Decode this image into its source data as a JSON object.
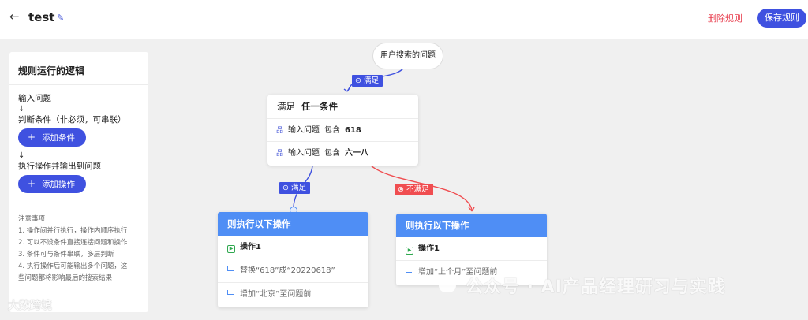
{
  "header": {
    "title": "test",
    "delete_label": "删除规则",
    "save_label": "保存规则"
  },
  "panel": {
    "title": "规则运行的逻辑",
    "step1": "输入问题",
    "arrow": "↓",
    "step2": "判断条件（非必须，可串联）",
    "add_condition": "添加条件",
    "step3": "执行操作并输出到问题",
    "add_action": "添加操作",
    "notes_title": "注意事项",
    "notes": [
      "1. 操作间并行执行，操作内顺序执行",
      "2. 可以不设条件直接连接问题和操作",
      "3. 条件可与条件串联，多层判断",
      "4. 执行操作后可能输出多个问题，这",
      "些问题都将影响最后的搜索结果"
    ]
  },
  "flow": {
    "start_node": "用户搜索的问题",
    "tag_satisfy_top": "满足",
    "condition": {
      "head_label": "满足",
      "head_value": "任一条件",
      "rows": [
        {
          "field": "输入问题",
          "op": "包含",
          "value": "618"
        },
        {
          "field": "输入问题",
          "op": "包含",
          "value": "六一八"
        }
      ]
    },
    "tag_satisfy": "满足",
    "tag_not_satisfy": "不满足",
    "action_left": {
      "head": "则执行以下操作",
      "op_name": "操作1",
      "steps": [
        "替换“618”成“20220618”",
        "增加“北京”至问题前"
      ]
    },
    "action_right": {
      "head": "则执行以下操作",
      "op_name": "操作1",
      "steps": [
        "增加“上个月”至问题前"
      ]
    }
  },
  "watermark": {
    "main": "公众号 · AI产品经理研习与实践",
    "corner": "大数跨境"
  },
  "colors": {
    "primary": "#3f51e0",
    "danger": "#f04d50",
    "action_header": "#4f8ef5"
  }
}
